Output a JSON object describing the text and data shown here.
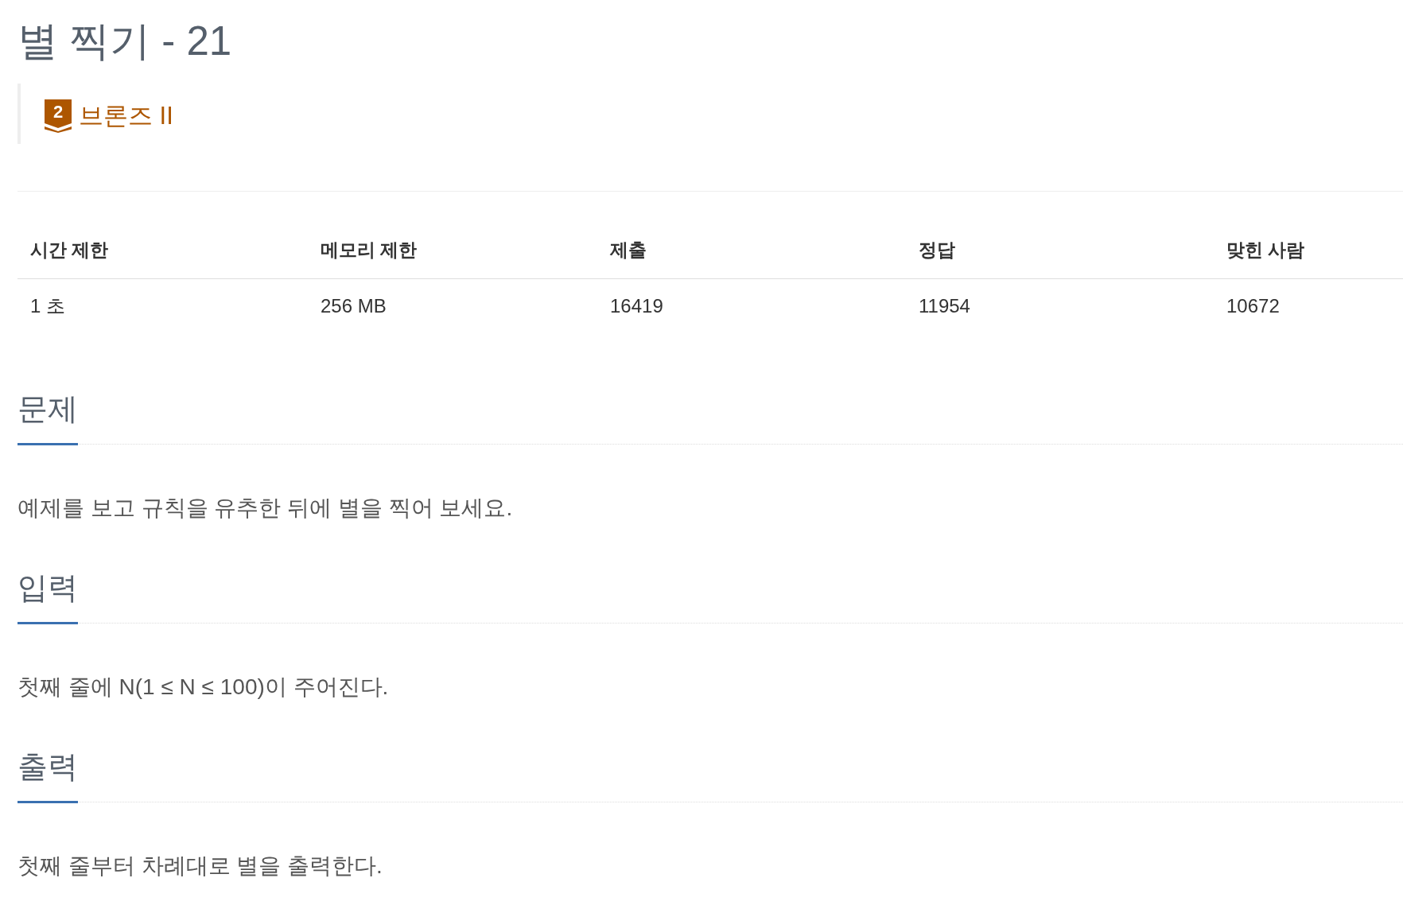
{
  "title": "별 찍기 - 21",
  "tier": {
    "rank": "2",
    "label": "브론즈 II"
  },
  "limits": {
    "columns": [
      "시간 제한",
      "메모리 제한",
      "제출",
      "정답",
      "맞힌 사람"
    ],
    "rows": [
      [
        "1 초",
        "256 MB",
        "16419",
        "11954",
        "10672"
      ]
    ]
  },
  "sections": [
    {
      "heading": "문제",
      "body": "예제를 보고 규칙을 유추한 뒤에 별을 찍어 보세요."
    },
    {
      "heading": "입력",
      "body": "첫째 줄에 N(1 ≤ N ≤ 100)이 주어진다."
    },
    {
      "heading": "출력",
      "body": "첫째 줄부터 차례대로 별을 출력한다."
    }
  ]
}
